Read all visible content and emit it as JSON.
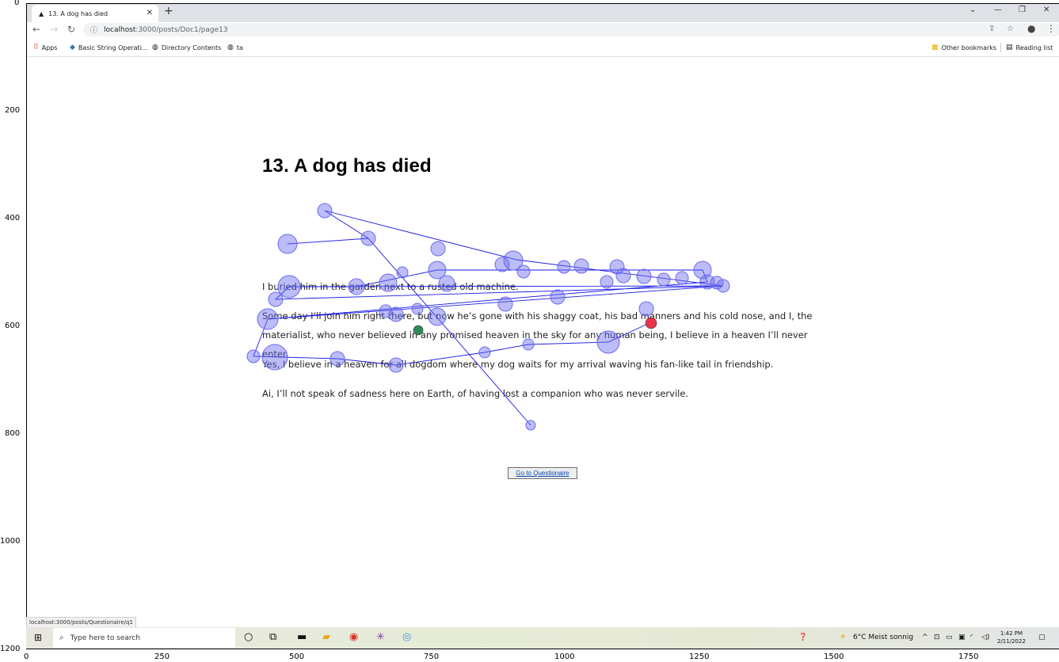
{
  "browser": {
    "tab_title": "13. A dog has died",
    "tab_favicon": "triangle-icon",
    "url_host": "localhost",
    "url_path": ":3000/posts/Doc1/page13",
    "bookmarks": [
      {
        "label": "Apps",
        "icon": "apps-grid-icon"
      },
      {
        "label": "Basic String Operati...",
        "icon": "python-icon"
      },
      {
        "label": "Directory Contents",
        "icon": "globe-icon"
      },
      {
        "label": "ta",
        "icon": "globe-icon"
      }
    ],
    "other_bookmarks": "Other bookmarks",
    "reading_list": "Reading list"
  },
  "axes": {
    "y_ticks": [
      "0",
      "200",
      "400",
      "600",
      "800",
      "1000",
      "1200"
    ],
    "x_ticks": [
      "0",
      "250",
      "500",
      "750",
      "1000",
      "1250",
      "1500",
      "1750"
    ]
  },
  "page": {
    "heading": "13. A dog has died",
    "paragraphs": [
      "I buried him in the garden next to a rusted old machine.",
      "Some day I’ll join him right there, but now he’s gone with his shaggy coat, his bad manners and his cold nose, and I, the materialist, who never believed in any promised heaven in the sky for any human being, I believe in a heaven I’ll never enter.",
      "Yes, I believe in a heaven for all dogdom where my dog waits for my arrival waving his fan-like tail in friendship.",
      "Ai, I’ll not speak of sadness here on Earth, of having lost a companion who was never servile."
    ],
    "questionnaire_button": "Go to Questionaire"
  },
  "gaze_overlay": {
    "point_color": "#6b6bf0",
    "line_color": "#1a1ae6",
    "start_color": "#2e8b57",
    "end_color": "#e8334a",
    "fixations": [
      {
        "x": 363,
        "y": 308,
        "r": 12
      },
      {
        "x": 465,
        "y": 301,
        "r": 9
      },
      {
        "x": 410,
        "y": 266,
        "r": 9
      },
      {
        "x": 365,
        "y": 362,
        "r": 14
      },
      {
        "x": 348,
        "y": 378,
        "r": 9
      },
      {
        "x": 338,
        "y": 403,
        "r": 13
      },
      {
        "x": 347,
        "y": 451,
        "r": 16
      },
      {
        "x": 320,
        "y": 450,
        "r": 8
      },
      {
        "x": 426,
        "y": 453,
        "r": 9
      },
      {
        "x": 500,
        "y": 461,
        "r": 9
      },
      {
        "x": 527,
        "y": 390,
        "r": 7
      },
      {
        "x": 487,
        "y": 393,
        "r": 8
      },
      {
        "x": 500,
        "y": 397,
        "r": 9
      },
      {
        "x": 552,
        "y": 400,
        "r": 11
      },
      {
        "x": 638,
        "y": 384,
        "r": 9
      },
      {
        "x": 704,
        "y": 375,
        "r": 9
      },
      {
        "x": 816,
        "y": 390,
        "r": 9
      },
      {
        "x": 450,
        "y": 362,
        "r": 10
      },
      {
        "x": 490,
        "y": 357,
        "r": 11
      },
      {
        "x": 508,
        "y": 344,
        "r": 7
      },
      {
        "x": 552,
        "y": 341,
        "r": 11
      },
      {
        "x": 564,
        "y": 358,
        "r": 10
      },
      {
        "x": 553,
        "y": 314,
        "r": 9
      },
      {
        "x": 634,
        "y": 334,
        "r": 9
      },
      {
        "x": 648,
        "y": 329,
        "r": 12
      },
      {
        "x": 661,
        "y": 343,
        "r": 8
      },
      {
        "x": 712,
        "y": 337,
        "r": 8
      },
      {
        "x": 734,
        "y": 336,
        "r": 9
      },
      {
        "x": 766,
        "y": 356,
        "r": 8
      },
      {
        "x": 779,
        "y": 337,
        "r": 9
      },
      {
        "x": 787,
        "y": 348,
        "r": 9
      },
      {
        "x": 813,
        "y": 349,
        "r": 9
      },
      {
        "x": 838,
        "y": 353,
        "r": 8
      },
      {
        "x": 861,
        "y": 351,
        "r": 8
      },
      {
        "x": 887,
        "y": 341,
        "r": 11
      },
      {
        "x": 893,
        "y": 356,
        "r": 9
      },
      {
        "x": 905,
        "y": 357,
        "r": 8
      },
      {
        "x": 913,
        "y": 361,
        "r": 8
      },
      {
        "x": 667,
        "y": 435,
        "r": 7
      },
      {
        "x": 612,
        "y": 445,
        "r": 7
      },
      {
        "x": 768,
        "y": 432,
        "r": 14
      },
      {
        "x": 670,
        "y": 537,
        "r": 6
      }
    ],
    "path": [
      [
        363,
        308
      ],
      [
        465,
        301
      ],
      [
        670,
        537
      ],
      [
        465,
        301
      ],
      [
        410,
        266
      ],
      [
        652,
        328
      ],
      [
        913,
        361
      ],
      [
        365,
        362
      ],
      [
        913,
        361
      ],
      [
        338,
        403
      ],
      [
        913,
        361
      ],
      [
        348,
        378
      ],
      [
        365,
        362
      ],
      [
        450,
        362
      ],
      [
        552,
        341
      ],
      [
        887,
        341
      ],
      [
        893,
        356
      ],
      [
        338,
        403
      ],
      [
        320,
        450
      ],
      [
        426,
        453
      ],
      [
        500,
        461
      ],
      [
        612,
        445
      ],
      [
        667,
        435
      ],
      [
        768,
        432
      ],
      [
        822,
        407
      ]
    ],
    "start": {
      "x": 528,
      "y": 417,
      "r": 6
    },
    "end": {
      "x": 822,
      "y": 408,
      "r": 7
    }
  },
  "status_bar": "localhost:3000/posts/Questionaire/q1",
  "taskbar": {
    "search_placeholder": "Type here to search",
    "weather": "6°C  Meist sonnig",
    "time": "1:42 PM",
    "date": "2/11/2022"
  }
}
